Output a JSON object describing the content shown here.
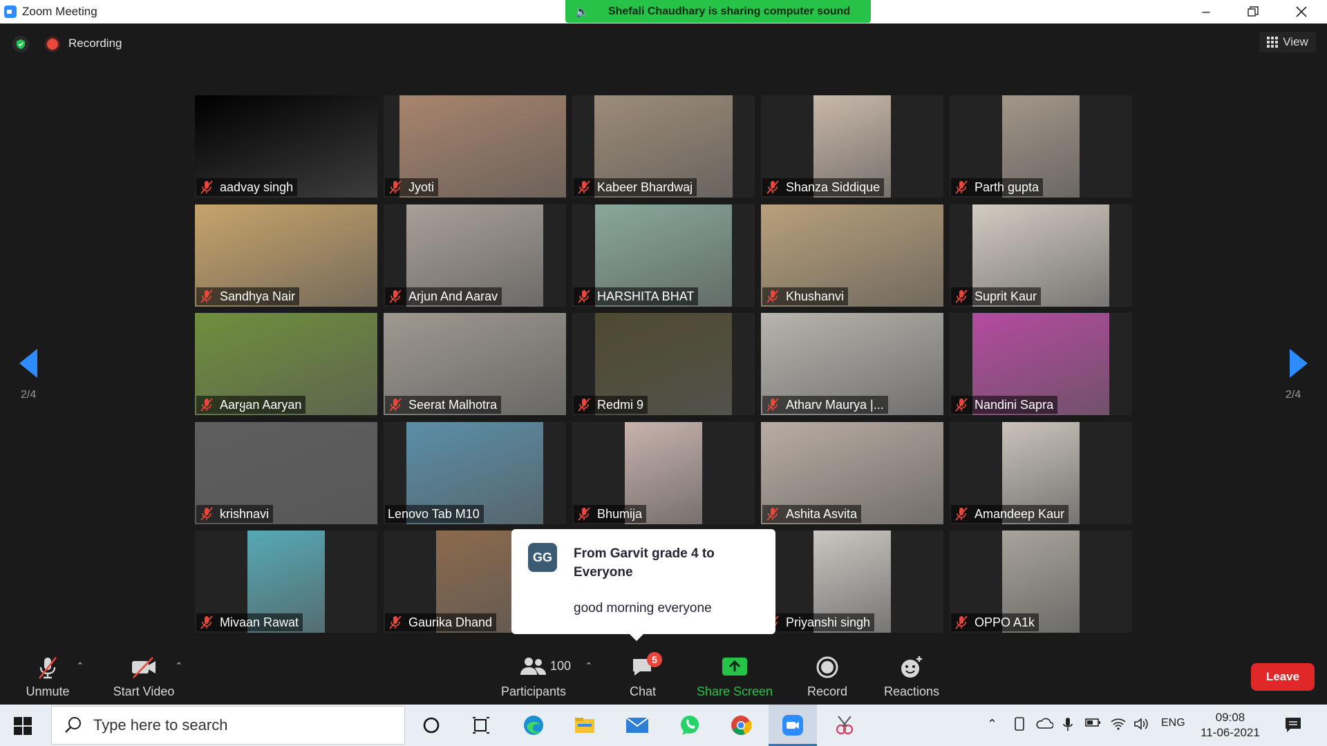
{
  "window": {
    "title": "Zoom Meeting"
  },
  "share_banner": {
    "text": "Shefali Chaudhary is sharing computer sound"
  },
  "status": {
    "recording_label": "Recording"
  },
  "view": {
    "label": "View"
  },
  "pager": {
    "left": "2/4",
    "right": "2/4"
  },
  "participants": [
    {
      "name": "aadvay singh",
      "bg": "#000000"
    },
    {
      "name": "Jyoti",
      "bg": "#a8846c"
    },
    {
      "name": "Kabeer Bhardwaj",
      "bg": "#9c8b78"
    },
    {
      "name": "Shanza Siddique",
      "bg": "#c9b8a9"
    },
    {
      "name": "Parth gupta",
      "bg": "#a29688"
    },
    {
      "name": "Sandhya Nair",
      "bg": "#c7a36a"
    },
    {
      "name": "Arjun And Aarav",
      "bg": "#a8a099"
    },
    {
      "name": "HARSHITA BHAT",
      "bg": "#88a89a"
    },
    {
      "name": "Khushanvi",
      "bg": "#b8a07a"
    },
    {
      "name": "Suprit Kaur",
      "bg": "#d2cbc1"
    },
    {
      "name": "Aarყan Aaryan",
      "bg": "#6f8f3c"
    },
    {
      "name": "Seerat Malhotra",
      "bg": "#9e9990"
    },
    {
      "name": "Redmi 9",
      "bg": "#4e4a30"
    },
    {
      "name": "Atharv Maurya |...",
      "bg": "#b7b4ae"
    },
    {
      "name": "Nandini Sapra",
      "bg": "#b54aa0"
    },
    {
      "name": "krishnavi",
      "bg": "#5e5e5e"
    },
    {
      "name": "Lenovo Tab M10",
      "bg": "#5a8fa8"
    },
    {
      "name": "Bhumija",
      "bg": "#c8b3ac"
    },
    {
      "name": "Ashita Asvita",
      "bg": "#b9ada2"
    },
    {
      "name": "Amandeep Kaur",
      "bg": "#c9c3bb"
    },
    {
      "name": "Mivaan Rawat",
      "bg": "#55a9b5"
    },
    {
      "name": "Gaurika Dhand",
      "bg": "#8c6a4c"
    },
    {
      "name": "",
      "bg": "#232323"
    },
    {
      "name": "Priyanshi singh",
      "bg": "#cbc7c2"
    },
    {
      "name": "OPPO A1k",
      "bg": "#a8a39b"
    }
  ],
  "chat_popup": {
    "initials": "GG",
    "from": "From Garvit grade 4 to Everyone",
    "message": "good morning everyone"
  },
  "toolbar": {
    "unmute": "Unmute",
    "start_video": "Start Video",
    "participants_label": "Participants",
    "participants_count": "100",
    "chat": "Chat",
    "chat_badge": "5",
    "share_screen": "Share Screen",
    "record": "Record",
    "reactions": "Reactions",
    "leave": "Leave"
  },
  "taskbar": {
    "search_placeholder": "Type here to search",
    "lang": "ENG",
    "time": "09:08",
    "date": "11-06-2021"
  },
  "colors": {
    "accent": "#2d8cff",
    "share_green": "#27c248",
    "leave_red": "#e02828"
  }
}
